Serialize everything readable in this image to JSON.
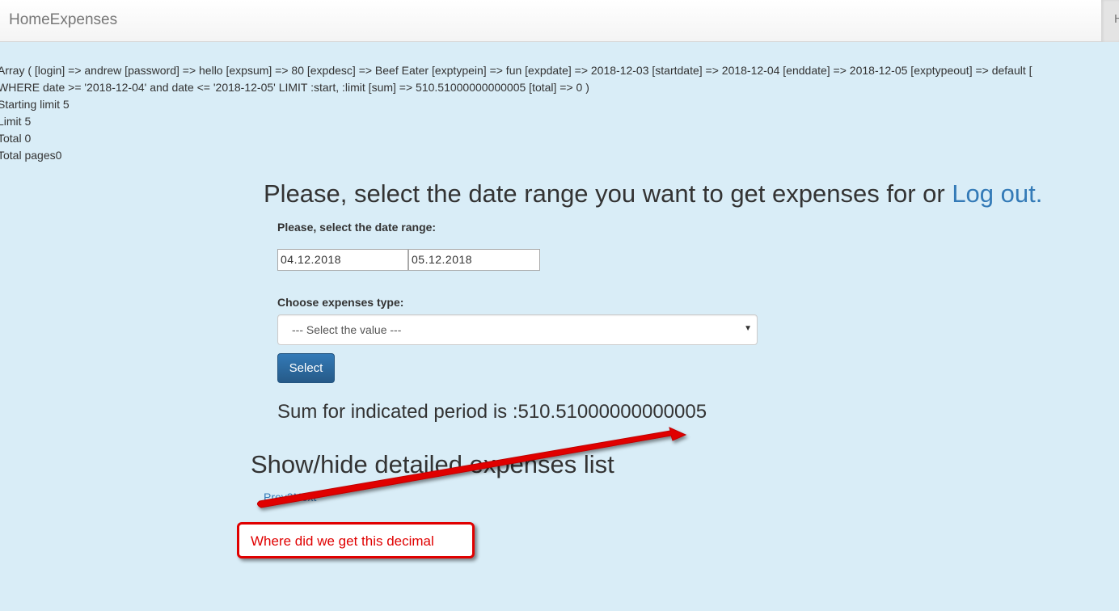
{
  "navbar": {
    "brand": "HomeExpenses",
    "right_item_partial": "H"
  },
  "debug_lines": [
    "Array ( [login] => andrew [password] => hello [expsum] => 80 [expdesc] => Beef Eater [exptypein] => fun [expdate] => 2018-12-03 [startdate] => 2018-12-04 [enddate] => 2018-12-05 [exptypeout] => default [",
    "WHERE date >= '2018-12-04' and date <= '2018-12-05' LIMIT :start, :limit [sum] => 510.51000000000005 [total] => 0 )",
    "Starting limit 5",
    "Limit 5",
    "Total 0",
    "Total pages0"
  ],
  "main": {
    "heading_text": "Please, select the date range you want to get expenses for or ",
    "logout_link": "Log out.",
    "date_range_label": "Please, select the date range:",
    "start_date": "04.12.2018",
    "end_date": "05.12.2018",
    "expenses_type_label": "Choose expenses type:",
    "expenses_type_selected": "--- Select the value ---",
    "select_button": "Select",
    "sum_text": "Sum for indicated period is :510.51000000000005",
    "toggle_heading": "Show/hide detailed expenses list",
    "pager": {
      "prev": "Prev",
      "page": "2",
      "next": "Next"
    }
  },
  "annotation": {
    "callout_text": "Where did we get this decimal",
    "color": "#e00000"
  },
  "colors": {
    "background": "#d9edf7",
    "link": "#337ab7",
    "button": "#337ab7"
  }
}
